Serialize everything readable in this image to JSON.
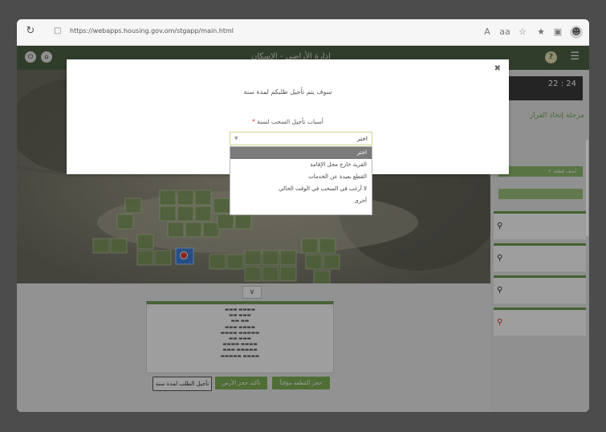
{
  "browser": {
    "url": "https://webapps.housing.gov.om/stgapp/main.html",
    "reload_icon": "reload-icon",
    "lock_icon": "lock-icon",
    "toolbar_icons": [
      "read-aloud-icon",
      "aa-icon",
      "favorite-icon",
      "collections-icon",
      "extensions-icon",
      "profile-icon"
    ]
  },
  "app_header": {
    "title": "إدارة الأراضي - الإسكان",
    "menu_icon": "hamburger-icon",
    "help_label": "?"
  },
  "modal": {
    "title": "سوف يتم تأجيل طلبكم لمدة سنة",
    "field_label": "أسباب تأجيل السحب لسنة",
    "required_mark": "*",
    "select_value": "اختر",
    "options": [
      "اختر",
      "القرية خارج محل الإقامة",
      "القطع بعيدة عن الخدمات",
      "لا أرغب في السحب في الوقت الحالي",
      "أخرى"
    ]
  },
  "sidebar": {
    "timer": "22 : 24",
    "stage_title": "مرحلة إتخاذ القرار",
    "add_button": "أضف قطعة +",
    "cards_count": 4
  },
  "bottom": {
    "buttons": {
      "postpone": "تأجيل الطلب لمدة سنة",
      "confirm": "تأكيد حجز الأرض",
      "hold": "حجز القطعة مؤقتاً"
    }
  },
  "colors": {
    "accent_green": "#7fb256",
    "header_green": "#4f6346",
    "selected_option": "#7a7a7a"
  }
}
